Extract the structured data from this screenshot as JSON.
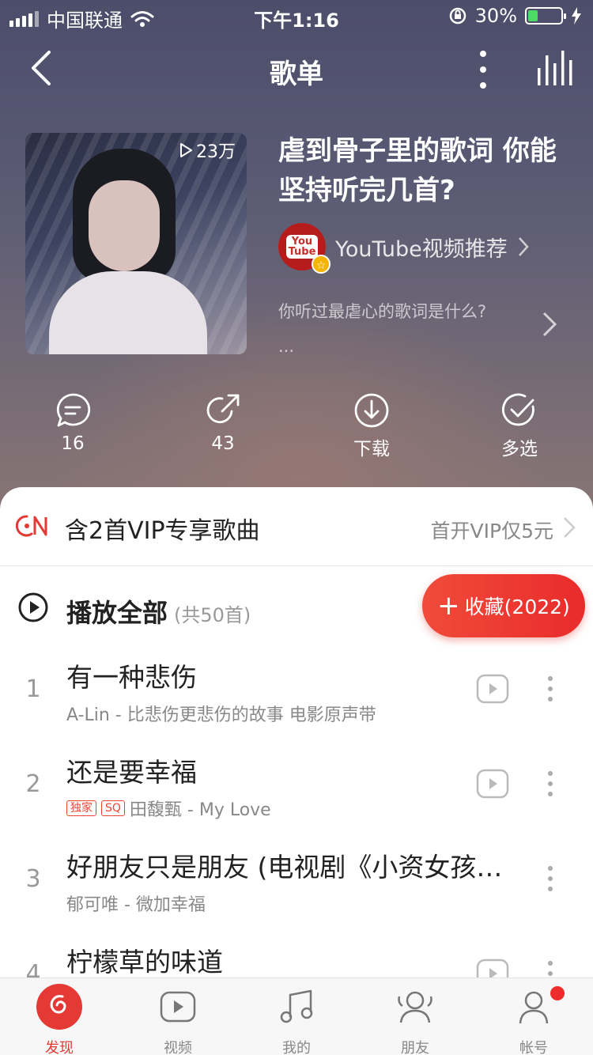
{
  "status": {
    "carrier": "中国联通",
    "time": "下午1:16",
    "battery_pct": "30%",
    "battery_level": 0.3,
    "battery_color": "#4cd964"
  },
  "nav": {
    "title": "歌单",
    "back_icon": "back-chevron-icon",
    "more_icon": "more-vertical-icon",
    "playing_icon": "equalizer-bars-icon"
  },
  "playlist": {
    "play_count": "23万",
    "title": "虐到骨子里的歌词 你能坚持听完几首?",
    "creator": "YouTube视频推荐",
    "creator_avatar_text": "You Tube",
    "description": "你听过最虐心的歌词是什么?",
    "description_more": "..."
  },
  "actions": [
    {
      "icon": "comment-icon",
      "label": "16"
    },
    {
      "icon": "share-icon",
      "label": "43"
    },
    {
      "icon": "download-icon",
      "label": "下载"
    },
    {
      "icon": "multi-select-icon",
      "label": "多选"
    }
  ],
  "vip": {
    "text": "含2首VIP专享歌曲",
    "promo": "首开VIP仅5元"
  },
  "play_all": {
    "label": "播放全部",
    "count": "(共50首)",
    "collect_label": "收藏(2022)"
  },
  "songs": [
    {
      "index": "1",
      "name": "有一种悲伤",
      "meta": "A-Lin - 比悲伤更悲伤的故事 电影原声带",
      "tags": []
    },
    {
      "index": "2",
      "name": "还是要幸福",
      "meta": "田馥甄 - My Love",
      "tags": [
        "独家",
        "SQ"
      ]
    },
    {
      "index": "3",
      "name": "好朋友只是朋友 (电视剧《小资女孩向前冲》插曲)",
      "meta": "郁可唯 - 微加幸福",
      "tags": []
    },
    {
      "index": "4",
      "name": "柠檬草的味道",
      "meta": "",
      "tags": []
    }
  ],
  "tabs": [
    {
      "label": "发现",
      "icon": "discover-icon",
      "active": true
    },
    {
      "label": "视频",
      "icon": "video-icon",
      "active": false
    },
    {
      "label": "我的",
      "icon": "music-note-icon",
      "active": false
    },
    {
      "label": "朋友",
      "icon": "friends-icon",
      "active": false
    },
    {
      "label": "帐号",
      "icon": "account-icon",
      "active": false,
      "badge": true
    }
  ],
  "colors": {
    "accent": "#e53935",
    "hero_top": "#4c4d6a",
    "hero_bottom": "#8a7675"
  }
}
